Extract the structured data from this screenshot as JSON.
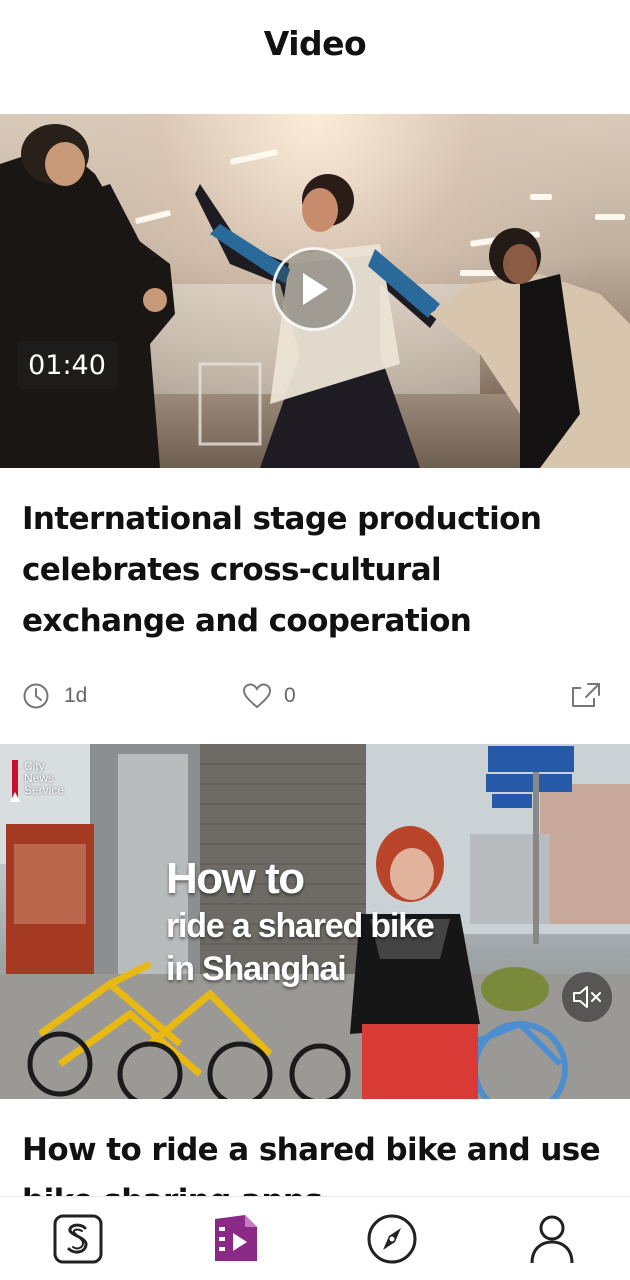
{
  "header": {
    "title": "Video"
  },
  "cards": [
    {
      "duration": "01:40",
      "title": "International stage production celebrates cross-cultural exchange and cooperation",
      "time_ago": "1d",
      "likes": "0"
    },
    {
      "source_logo_text": [
        "City",
        "News",
        "Service"
      ],
      "overlay_lines": [
        "How to",
        "ride a shared bike",
        "in Shanghai"
      ],
      "title": "How to ride a shared bike and use bike sharing apps"
    }
  ],
  "bottom_nav": {
    "items": [
      {
        "icon": "shine-logo-icon",
        "active": false
      },
      {
        "icon": "video-icon",
        "active": true
      },
      {
        "icon": "compass-icon",
        "active": false
      },
      {
        "icon": "profile-icon",
        "active": false
      }
    ],
    "accent": "#8b2a86"
  },
  "colors": {
    "text": "#111111",
    "meta": "#666666",
    "accent": "#8b2a86"
  }
}
